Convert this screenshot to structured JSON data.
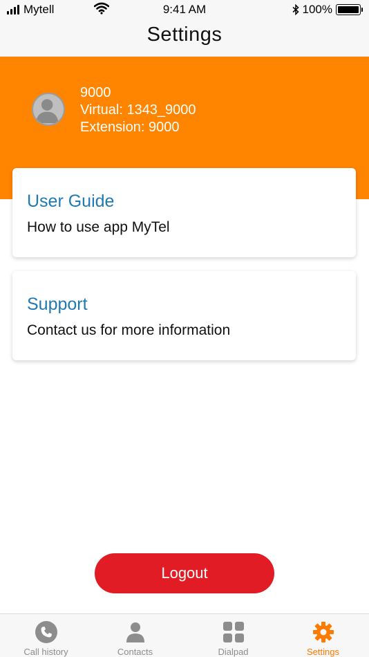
{
  "status_bar": {
    "carrier": "Mytell",
    "time": "9:41 AM",
    "battery": "100%"
  },
  "header": {
    "title": "Settings"
  },
  "profile": {
    "number": "9000",
    "virtual": "Virtual: 1343_9000",
    "extension": "Extension: 9000"
  },
  "cards": [
    {
      "title": "User Guide",
      "description": "How to use app MyTel"
    },
    {
      "title": "Support",
      "description": "Contact us for more information"
    }
  ],
  "logout_label": "Logout",
  "tabs": [
    {
      "label": "Call history",
      "icon": "phone-icon"
    },
    {
      "label": "Contacts",
      "icon": "person-icon"
    },
    {
      "label": "Dialpad",
      "icon": "grid-icon"
    },
    {
      "label": "Settings",
      "icon": "gear-icon",
      "active": true
    }
  ],
  "colors": {
    "brand_orange": "#ff8400",
    "title_blue": "#1f7ab4",
    "logout_red": "#e11c24",
    "tab_inactive": "#8d8d8d",
    "tab_active": "#ff7a00"
  }
}
